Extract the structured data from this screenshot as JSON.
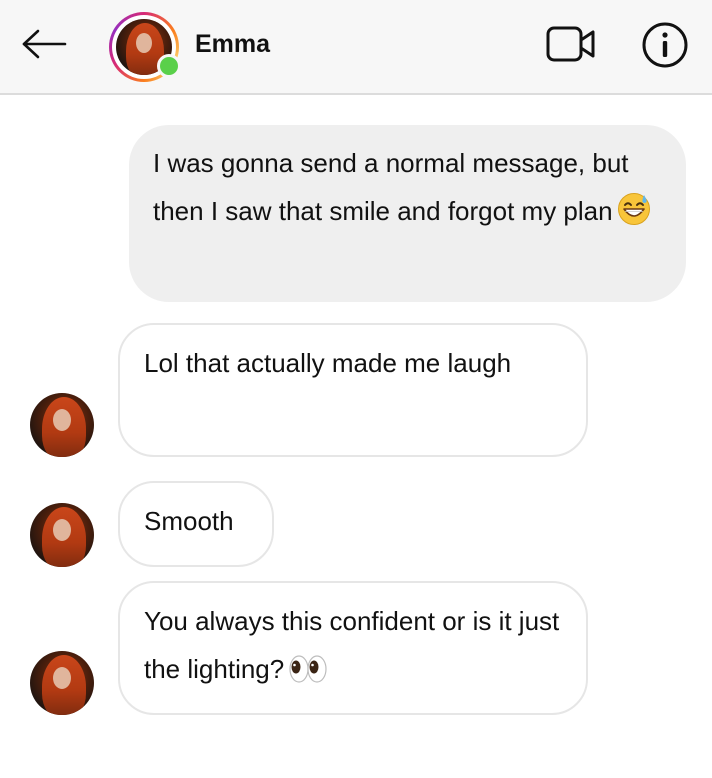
{
  "header": {
    "back_icon": "arrow-left-icon",
    "contact_name": "Emma",
    "online_status_color": "#5ad04a",
    "story_ring_colors": [
      "#d62976",
      "#fa7e1e",
      "#feda75",
      "#962fbf"
    ],
    "video_call_icon": "video-camera-icon",
    "info_icon": "info-circle-icon"
  },
  "messages": [
    {
      "direction": "sent",
      "text": "I was gonna send a normal message, but then I saw that smile and forgot my plan",
      "emoji": "grinning-sweat-emoji"
    },
    {
      "direction": "received",
      "text": "Lol that actually made me laugh"
    },
    {
      "direction": "received",
      "text": "Smooth"
    },
    {
      "direction": "received",
      "text": "You always this confident or is it just the lighting?",
      "emoji": "eyes-emoji"
    }
  ],
  "colors": {
    "sent_bubble": "#efefef",
    "received_bubble_border": "#e6e6e6",
    "header_background": "#f7f7f7"
  }
}
